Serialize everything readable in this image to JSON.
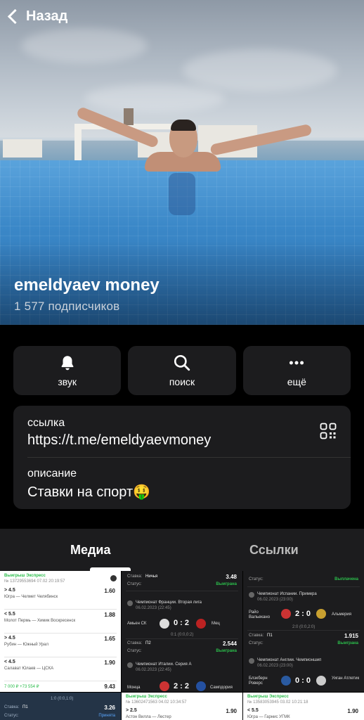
{
  "header": {
    "back_label": "Назад"
  },
  "channel": {
    "name": "emeldyaev money",
    "subscribers": "1 577 подписчиков"
  },
  "actions": [
    {
      "label": "звук",
      "icon": "bell-icon"
    },
    {
      "label": "поиск",
      "icon": "search-icon"
    },
    {
      "label": "ещё",
      "icon": "more-icon"
    }
  ],
  "info": {
    "link_key": "ссылка",
    "link_value": "https://t.me/emeldyaevmoney",
    "description_key": "описание",
    "description_value": "Ставки на спорт🤑"
  },
  "tabs": [
    {
      "label": "Медиа",
      "active": true
    },
    {
      "label": "Ссылки",
      "active": false
    }
  ],
  "media": {
    "c1": {
      "title": "Выигрыш Экспресс",
      "id": "№ 13729553694  07.02 20:19:57",
      "rows": [
        {
          "bet": "> 4.5",
          "match": "Югра — Челмет Челябинск",
          "odd": "1.60"
        },
        {
          "bet": "< 5.5",
          "match": "Молот Пермь — Химик Воскресенск",
          "odd": "1.88"
        },
        {
          "bet": "> 4.5",
          "match": "Рубин — Южный Урал",
          "odd": "1.65"
        },
        {
          "bet": "< 4.5",
          "match": "Салават Юлаев — ЦСКА",
          "odd": "1.90"
        }
      ],
      "total_odd": "9.43",
      "win": "7 000 ₽  +73 554 ₽"
    },
    "c2": {
      "top_label": "Ставка:",
      "top_pick": "Ничья",
      "top_odd": "3.48",
      "status_label": "Статус:",
      "status": "Выиграна",
      "league1": "Чемпионат Франции. Вторая лига",
      "date1": "06.02.2023 (22:45)",
      "home1": "Амьен СК",
      "score1": "0 : 2",
      "away1": "Мец",
      "half1": "0:1 (0:0,0:2)",
      "pick2": "П2",
      "odd2": "2.544",
      "league2": "Чемпионат Италии. Серия А",
      "date2": "06.02.2023 (22:45)",
      "home2": "Монца",
      "score2": "2 : 2",
      "away2": "Сампдория"
    },
    "c3": {
      "status_label": "Статус:",
      "status": "Выплачена",
      "league1": "Чемпионат Испании. Примера",
      "date1": "06.02.2023 (23:00)",
      "home1": "Райо Вальекано",
      "score1": "2 : 0",
      "away1": "Альмерия",
      "half1": "2:0 (0:0,2:0)",
      "pick": "П1",
      "odd": "1.915",
      "status2": "Выиграна",
      "league2": "Чемпионат Англии. Чемпионшип",
      "date2": "06.02.2023 (23:00)",
      "home2": "Блэкберн Роверс",
      "score2": "0 : 0",
      "away2": "Уиган Атлетик"
    },
    "c4": {
      "score": "1:0 (0:0,1:0)",
      "pick_label": "Ставка:",
      "pick": "П1",
      "odd": "3.26",
      "status_label": "Статус:",
      "status": "Принята"
    },
    "c5": {
      "title": "Выигрыш Экспресс",
      "id": "№ 13602471563  04.02 10:34:57",
      "bet": "> 2.5",
      "match": "Астон Вилла — Лестер",
      "odd": "1.90"
    },
    "c6": {
      "title": "Выигрыш Экспресс",
      "id": "№ 13583053945  03.02 10:21:18",
      "bet": "< 5.5",
      "match": "Югра — Гарнис УГМК",
      "odd": "1.90"
    }
  }
}
